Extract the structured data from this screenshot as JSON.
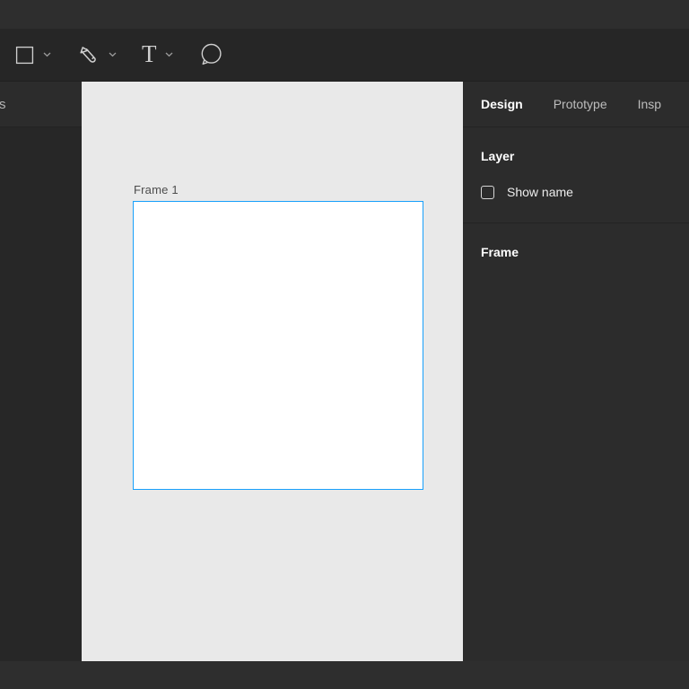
{
  "toolbar": {
    "tools": [
      {
        "id": "shape-tool",
        "icon": "rectangle-icon",
        "dropdown": true
      },
      {
        "id": "pen-tool",
        "icon": "pen-icon",
        "dropdown": true
      },
      {
        "id": "text-tool",
        "icon": "text-tool-icon",
        "glyph": "T",
        "dropdown": true
      },
      {
        "id": "comment-tool",
        "icon": "comment-bubble-icon",
        "dropdown": false
      }
    ]
  },
  "left_panel": {
    "cutoff_text": "s"
  },
  "canvas": {
    "frame_label": "Frame 1"
  },
  "right_panel": {
    "tabs": [
      {
        "label": "Design",
        "active": true
      },
      {
        "label": "Prototype",
        "active": false
      },
      {
        "label": "Insp",
        "active": false
      }
    ],
    "sections": {
      "layer": {
        "title": "Layer",
        "show_name": {
          "label": "Show name",
          "checked": false
        }
      },
      "frame": {
        "title": "Frame"
      }
    }
  },
  "colors": {
    "accent_blue": "#18a0fb",
    "canvas_bg": "#e9e9e9",
    "panel_bg": "#2c2c2c",
    "toolbar_bg": "#262626",
    "window_strip": "#2e2e2e",
    "left_panel_content_bg": "#272727",
    "frame_fill": "#ffffff",
    "frame_label_text": "#4d4d4d",
    "icon_stroke": "#cfcfcf",
    "active_tab_text": "#ffffff",
    "inactive_tab_text": "#bdbdbd"
  }
}
